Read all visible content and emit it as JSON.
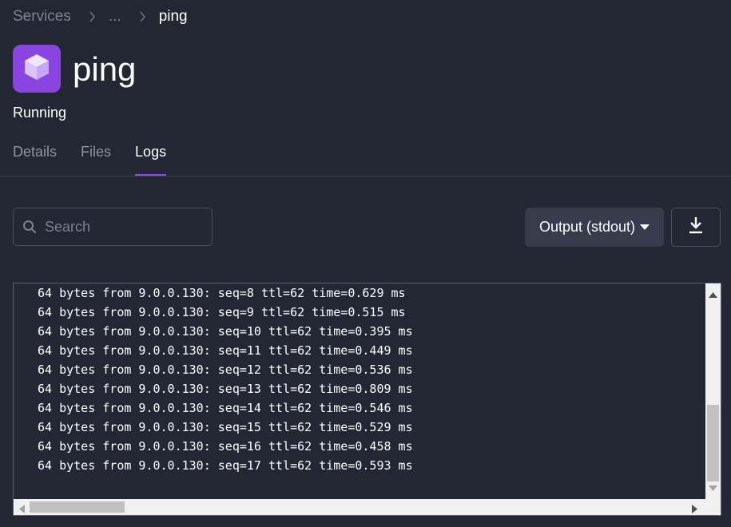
{
  "breadcrumb": {
    "root": "Services",
    "ellipsis": "...",
    "current": "ping"
  },
  "service": {
    "name": "ping",
    "status": "Running",
    "icon": "cube-icon",
    "icon_color": "#8a45e0"
  },
  "tabs": [
    {
      "label": "Details",
      "active": false
    },
    {
      "label": "Files",
      "active": false
    },
    {
      "label": "Logs",
      "active": true
    }
  ],
  "search": {
    "placeholder": "Search",
    "value": ""
  },
  "output_select": {
    "label": "Output (stdout)"
  },
  "download": {
    "icon": "download-icon"
  },
  "logs": [
    "64 bytes from 9.0.0.130: seq=8 ttl=62 time=0.629 ms",
    "64 bytes from 9.0.0.130: seq=9 ttl=62 time=0.515 ms",
    "64 bytes from 9.0.0.130: seq=10 ttl=62 time=0.395 ms",
    "64 bytes from 9.0.0.130: seq=11 ttl=62 time=0.449 ms",
    "64 bytes from 9.0.0.130: seq=12 ttl=62 time=0.536 ms",
    "64 bytes from 9.0.0.130: seq=13 ttl=62 time=0.809 ms",
    "64 bytes from 9.0.0.130: seq=14 ttl=62 time=0.546 ms",
    "64 bytes from 9.0.0.130: seq=15 ttl=62 time=0.529 ms",
    "64 bytes from 9.0.0.130: seq=16 ttl=62 time=0.458 ms",
    "64 bytes from 9.0.0.130: seq=17 ttl=62 time=0.593 ms"
  ],
  "colors": {
    "background": "#232733",
    "accent": "#8a4fe6",
    "button": "#363c4c"
  }
}
